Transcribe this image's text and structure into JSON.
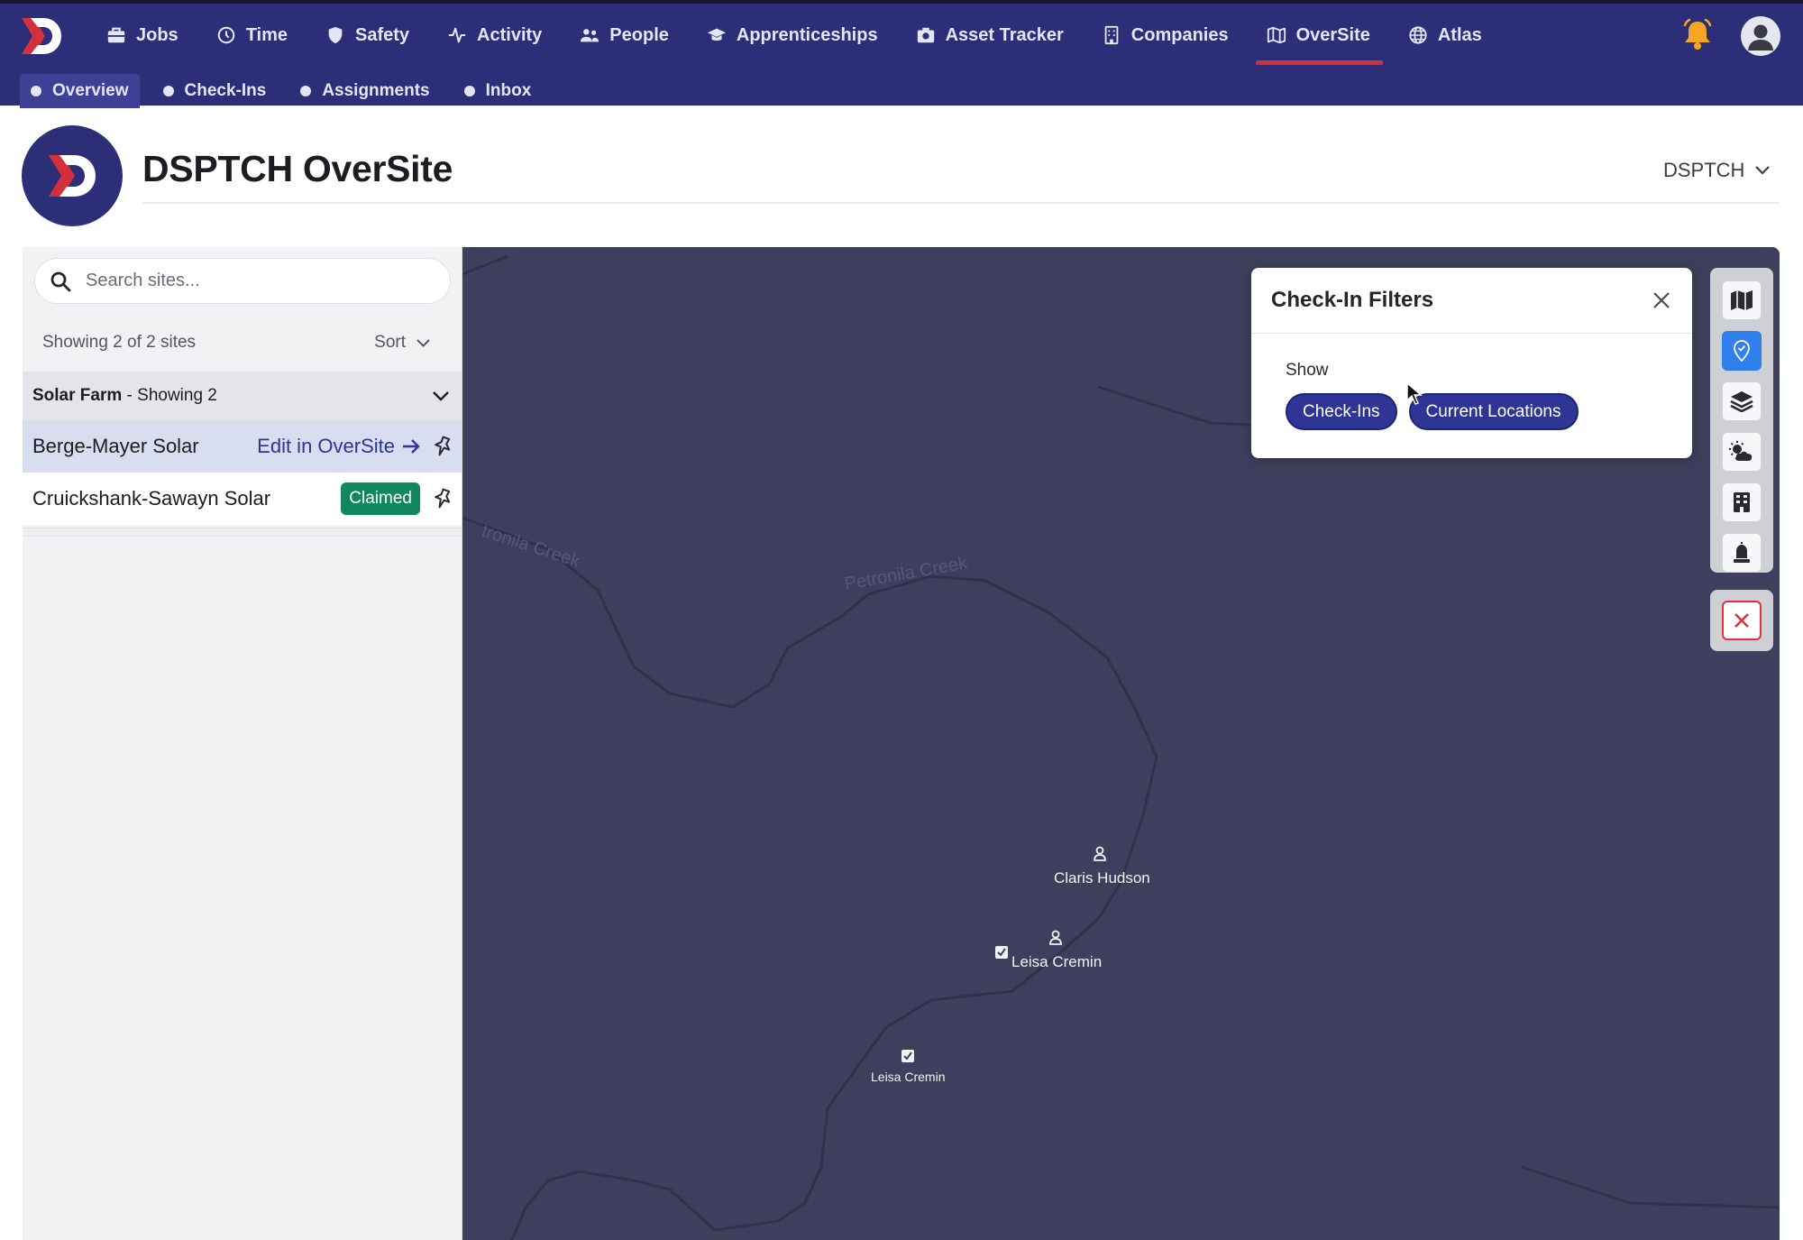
{
  "nav": {
    "items": [
      {
        "label": "Jobs",
        "icon": "briefcase-icon"
      },
      {
        "label": "Time",
        "icon": "clock-icon"
      },
      {
        "label": "Safety",
        "icon": "shield-icon"
      },
      {
        "label": "Activity",
        "icon": "pulse-icon"
      },
      {
        "label": "People",
        "icon": "users-icon"
      },
      {
        "label": "Apprenticeships",
        "icon": "graduation-cap-icon"
      },
      {
        "label": "Asset Tracker",
        "icon": "camera-icon"
      },
      {
        "label": "Companies",
        "icon": "building-icon"
      },
      {
        "label": "OverSite",
        "icon": "map-icon"
      },
      {
        "label": "Atlas",
        "icon": "globe-icon"
      }
    ],
    "active": "OverSite"
  },
  "subnav": {
    "items": [
      "Overview",
      "Check-Ins",
      "Assignments",
      "Inbox"
    ],
    "active": "Overview"
  },
  "header": {
    "title": "DSPTCH OverSite",
    "org": "DSPTCH"
  },
  "sidebar": {
    "search_placeholder": "Search sites...",
    "count_text": "Showing 2 of 2 sites",
    "sort_label": "Sort",
    "group": {
      "name": "Solar Farm",
      "suffix": " - Showing 2"
    },
    "sites": [
      {
        "name": "Berge-Mayer Solar",
        "action": "Edit in OverSite"
      },
      {
        "name": "Cruickshank-Sawayn Solar",
        "badge": "Claimed"
      }
    ]
  },
  "map": {
    "creek_labels": [
      "tronila Creek",
      "Petronila Creek"
    ],
    "markers": [
      {
        "name": "Claris Hudson",
        "type": "current-location"
      },
      {
        "name": "Leisa Cremin",
        "type": "current-location"
      },
      {
        "name": "Leisa Cremin",
        "type": "check-in"
      }
    ]
  },
  "filters": {
    "title": "Check-In Filters",
    "show_label": "Show",
    "chips": [
      "Check-Ins",
      "Current Locations"
    ]
  },
  "colors": {
    "nav_bg": "#2c2f78",
    "accent": "#2e3594",
    "active_underline": "#d2303a",
    "map_bg": "#3d3f5c",
    "claimed": "#10875c",
    "tool_active": "#2f80ed",
    "danger": "#e0303a"
  }
}
